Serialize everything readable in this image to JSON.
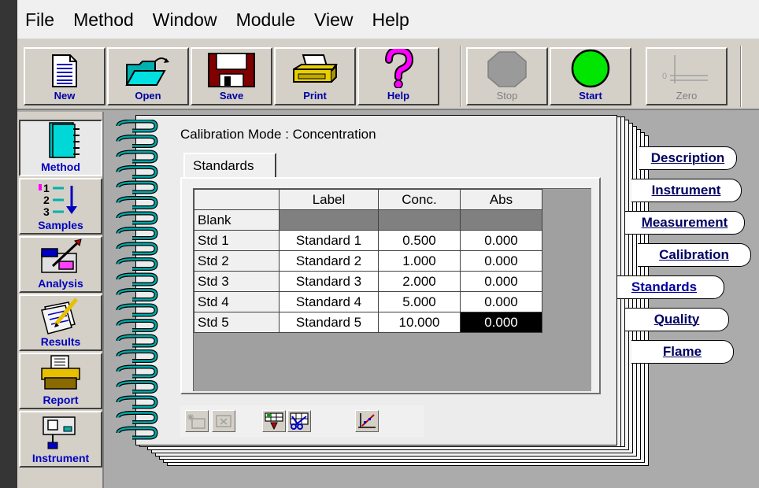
{
  "menu": [
    "File",
    "Method",
    "Window",
    "Module",
    "View",
    "Help"
  ],
  "toolbar": {
    "new": "New",
    "open": "Open",
    "save": "Save",
    "print": "Print",
    "help": "Help",
    "stop": "Stop",
    "start": "Start",
    "zero": "Zero"
  },
  "nav": {
    "method": "Method",
    "samples": "Samples",
    "analysis": "Analysis",
    "results": "Results",
    "report": "Report",
    "instrument": "Instrument"
  },
  "notebook": {
    "calibration_mode": "Calibration Mode : Concentration",
    "tab_label": "Standards",
    "columns": [
      "Label",
      "Conc.",
      "Abs"
    ],
    "rows": [
      {
        "name": "Blank",
        "label": "",
        "conc": "",
        "abs": ""
      },
      {
        "name": "Std 1",
        "label": "Standard 1",
        "conc": "0.500",
        "abs": "0.000"
      },
      {
        "name": "Std 2",
        "label": "Standard 2",
        "conc": "1.000",
        "abs": "0.000"
      },
      {
        "name": "Std 3",
        "label": "Standard 3",
        "conc": "2.000",
        "abs": "0.000"
      },
      {
        "name": "Std 4",
        "label": "Standard 4",
        "conc": "5.000",
        "abs": "0.000"
      },
      {
        "name": "Std 5",
        "label": "Standard 5",
        "conc": "10.000",
        "abs": "0.000"
      }
    ]
  },
  "side_tabs": {
    "description": "Description",
    "instrument": "Instrument",
    "measurement": "Measurement",
    "calibration": "Calibration",
    "standards": "Standards",
    "quality": "Quality",
    "flame": "Flame"
  },
  "colors": {
    "toolbar_bg": "#d4d0c8",
    "label_blue": "#0000c0",
    "start_green": "#00e000",
    "stop_gray": "#9a9a9a",
    "help_magenta": "#e000e0"
  }
}
